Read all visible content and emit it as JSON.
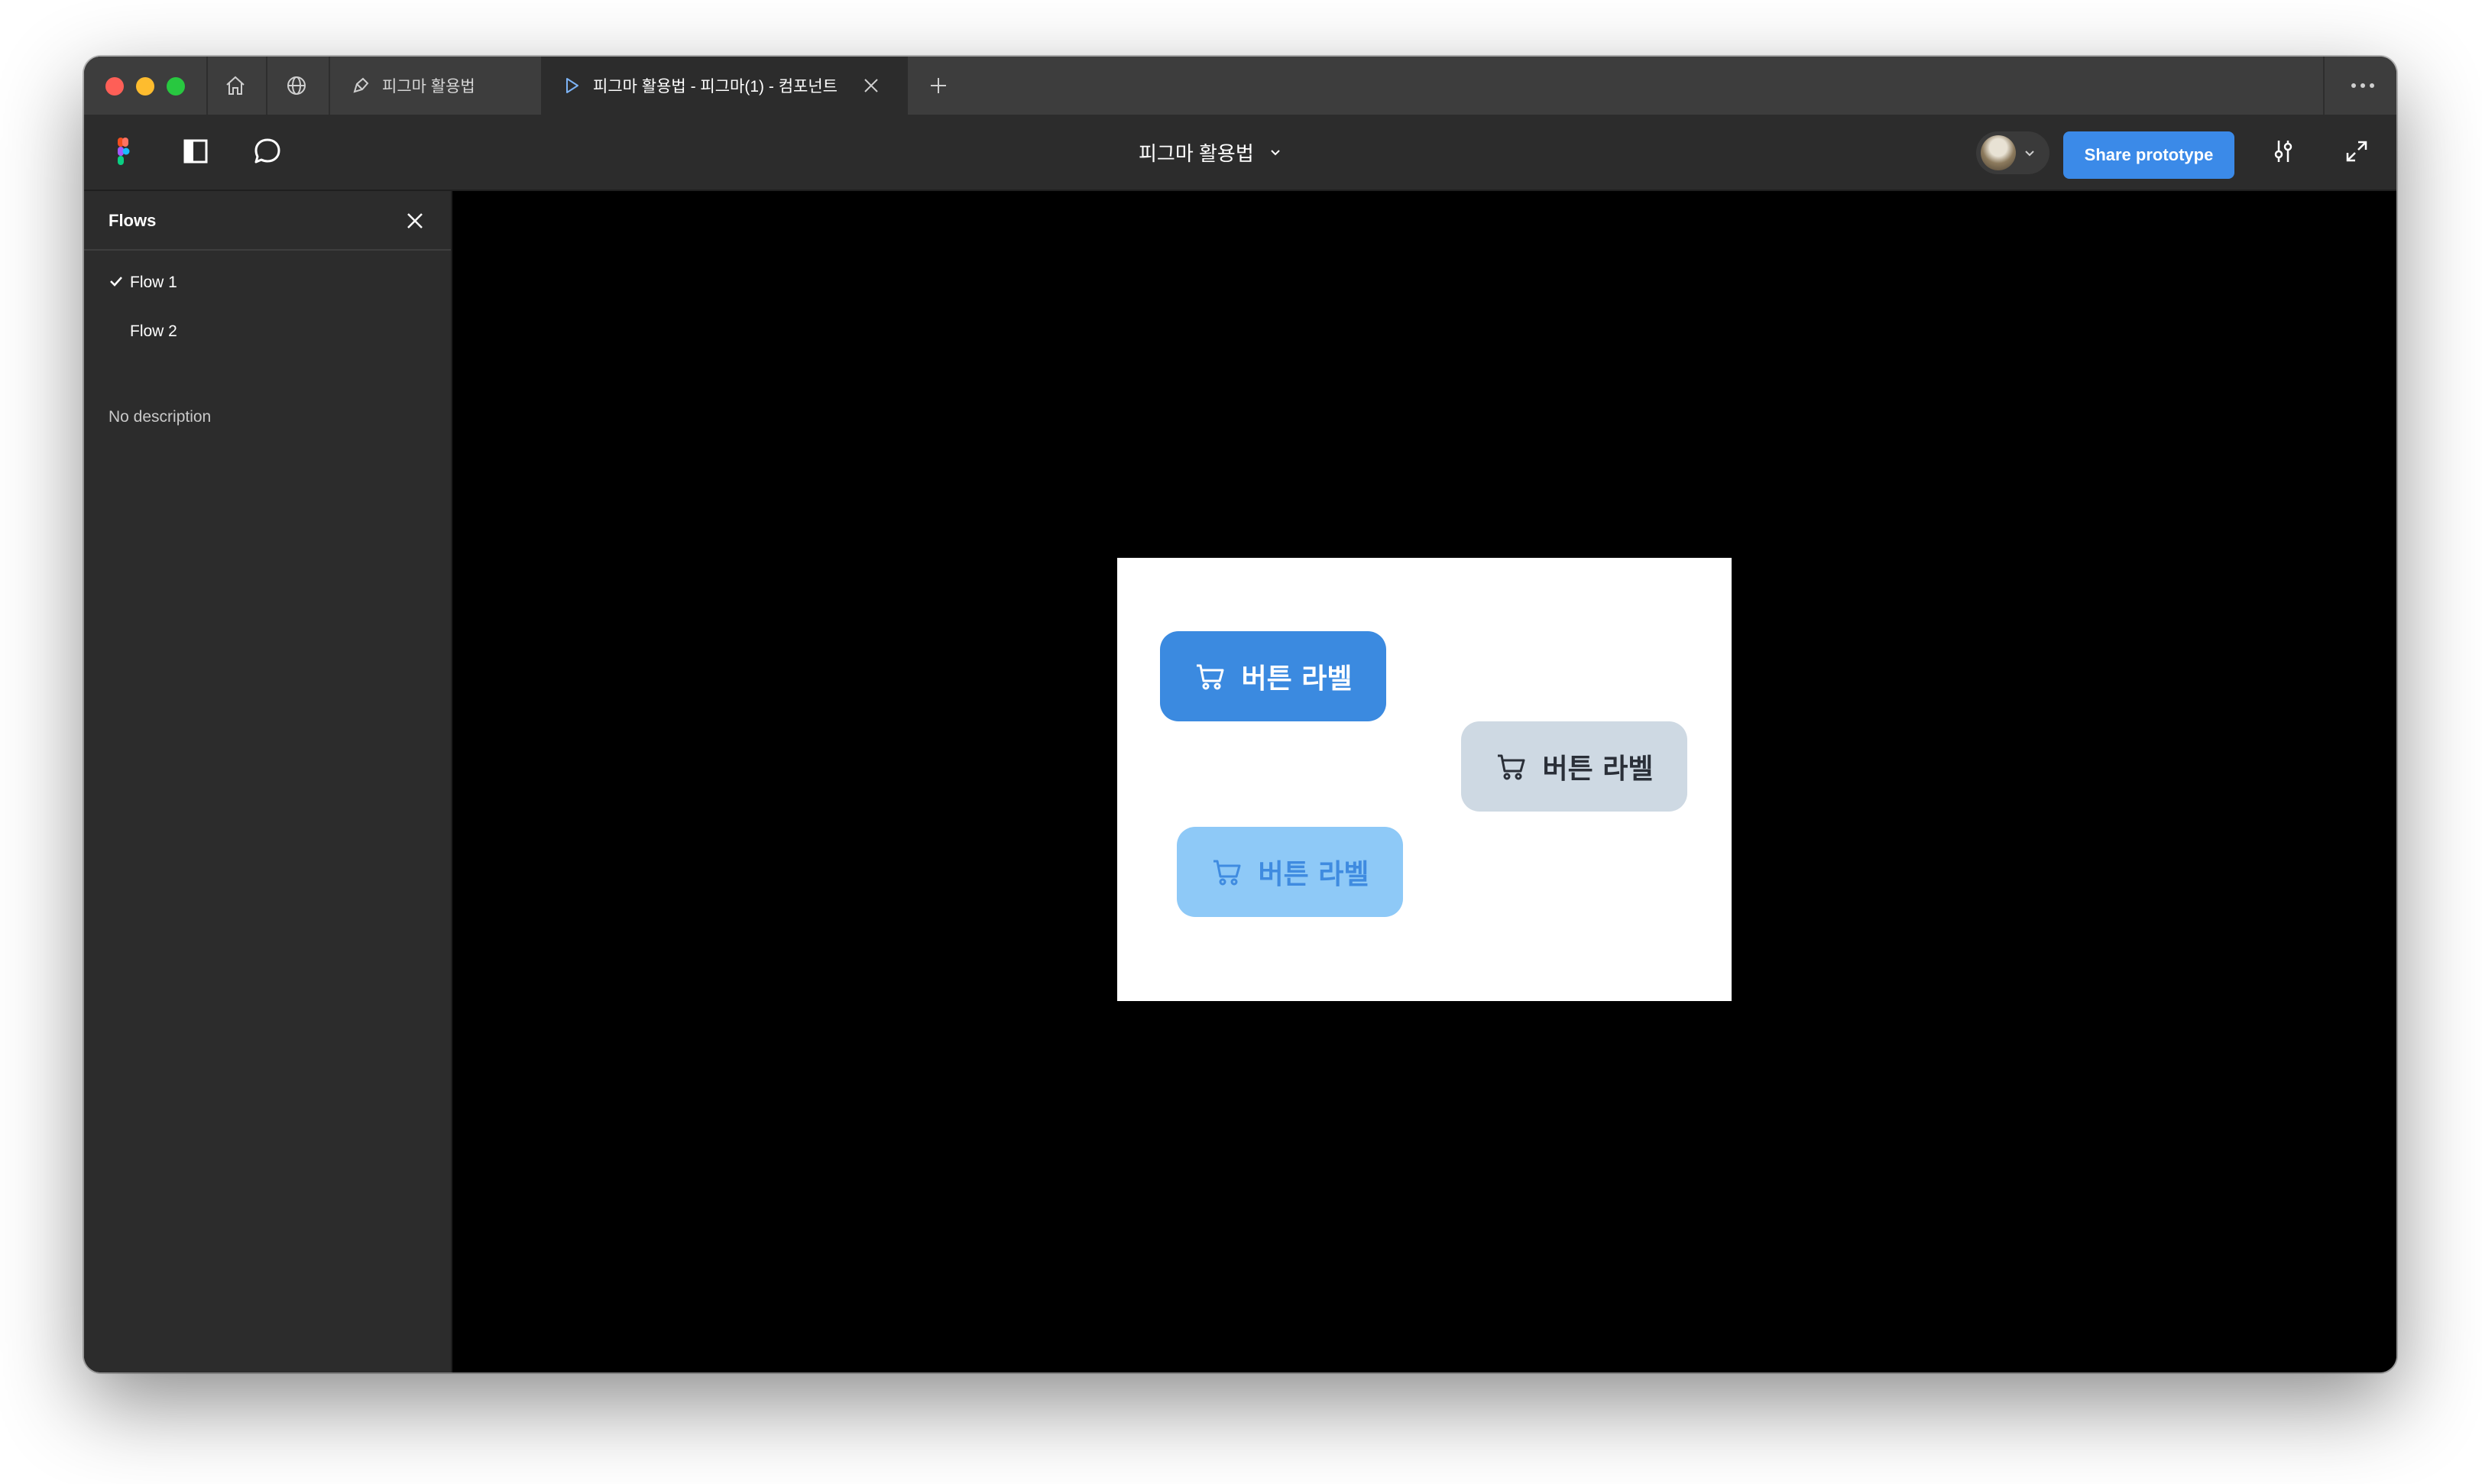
{
  "window": {
    "tabs": [
      {
        "label": "피그마 활용법",
        "icon": "figma-file-icon",
        "active": false
      },
      {
        "label": "피그마 활용법 - 피그마(1) - 컴포넌트",
        "icon": "play-icon",
        "active": true
      }
    ]
  },
  "toolbar": {
    "file_title": "피그마 활용법",
    "share_label": "Share prototype"
  },
  "flows_panel": {
    "title": "Flows",
    "items": [
      {
        "label": "Flow 1",
        "selected": true
      },
      {
        "label": "Flow 2",
        "selected": false
      }
    ],
    "description": "No description"
  },
  "prototype": {
    "buttons": [
      {
        "label": "버튼 라벨",
        "variant": "primary",
        "bg": "#3b8ae0",
        "fg": "#ffffff"
      },
      {
        "label": "버튼 라벨",
        "variant": "secondary",
        "bg": "#ced9e3",
        "fg": "#2a2f38"
      },
      {
        "label": "버튼 라벨",
        "variant": "disabled",
        "bg": "#8ec9f7",
        "fg": "#3f8be0"
      }
    ]
  },
  "colors": {
    "accent": "#3b8ae8",
    "panel_bg": "#2c2c2c",
    "canvas_bg": "#000000"
  }
}
